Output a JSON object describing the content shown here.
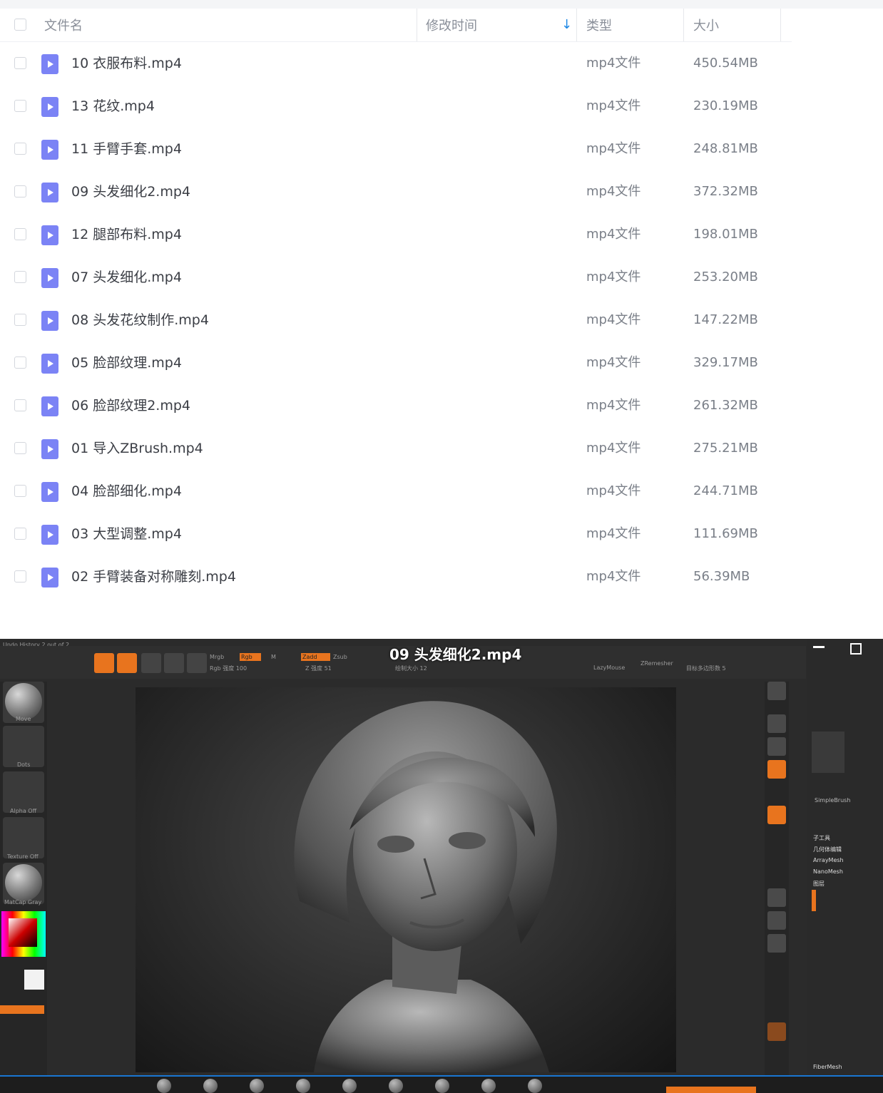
{
  "header": {
    "name_col": "文件名",
    "modified_col": "修改时间",
    "type_col": "类型",
    "size_col": "大小"
  },
  "files": [
    {
      "name": "10 衣服布料.mp4",
      "type": "mp4文件",
      "size": "450.54MB"
    },
    {
      "name": "13 花纹.mp4",
      "type": "mp4文件",
      "size": "230.19MB"
    },
    {
      "name": "11 手臂手套.mp4",
      "type": "mp4文件",
      "size": "248.81MB"
    },
    {
      "name": "09 头发细化2.mp4",
      "type": "mp4文件",
      "size": "372.32MB"
    },
    {
      "name": "12 腿部布料.mp4",
      "type": "mp4文件",
      "size": "198.01MB"
    },
    {
      "name": "07 头发细化.mp4",
      "type": "mp4文件",
      "size": "253.20MB"
    },
    {
      "name": "08 头发花纹制作.mp4",
      "type": "mp4文件",
      "size": "147.22MB"
    },
    {
      "name": "05 脸部纹理.mp4",
      "type": "mp4文件",
      "size": "329.17MB"
    },
    {
      "name": "06 脸部纹理2.mp4",
      "type": "mp4文件",
      "size": "261.32MB"
    },
    {
      "name": "01 导入ZBrush.mp4",
      "type": "mp4文件",
      "size": "275.21MB"
    },
    {
      "name": "04 脸部细化.mp4",
      "type": "mp4文件",
      "size": "244.71MB"
    },
    {
      "name": "03 大型调整.mp4",
      "type": "mp4文件",
      "size": "111.69MB"
    },
    {
      "name": "02 手臂装备对称雕刻.mp4",
      "type": "mp4文件",
      "size": "56.39MB"
    }
  ],
  "video": {
    "title": "09 头发细化2.mp4",
    "undo_history": "Undo History 2 out of 2",
    "left_labels": [
      "Move",
      "Dots",
      "Alpha Off",
      "Texture Off",
      "MatCap Gray"
    ],
    "toolbar_labels": [
      "Mrgb",
      "Rgb",
      "M",
      "Zadd",
      "Zsub",
      "Rgb 强度 100",
      "Z 强度 51",
      "绘制大小 12",
      "LazyMouse",
      "ZRemesher",
      "目标多边形数 5"
    ],
    "tool_panel": [
      "子工具",
      "几何体编辑",
      "ArrayMesh",
      "NanoMesh",
      "图层",
      "SimpleBrush",
      "FiberMesh"
    ],
    "accent_orange": "#e8741e",
    "accent_blue": "#1976d2"
  }
}
